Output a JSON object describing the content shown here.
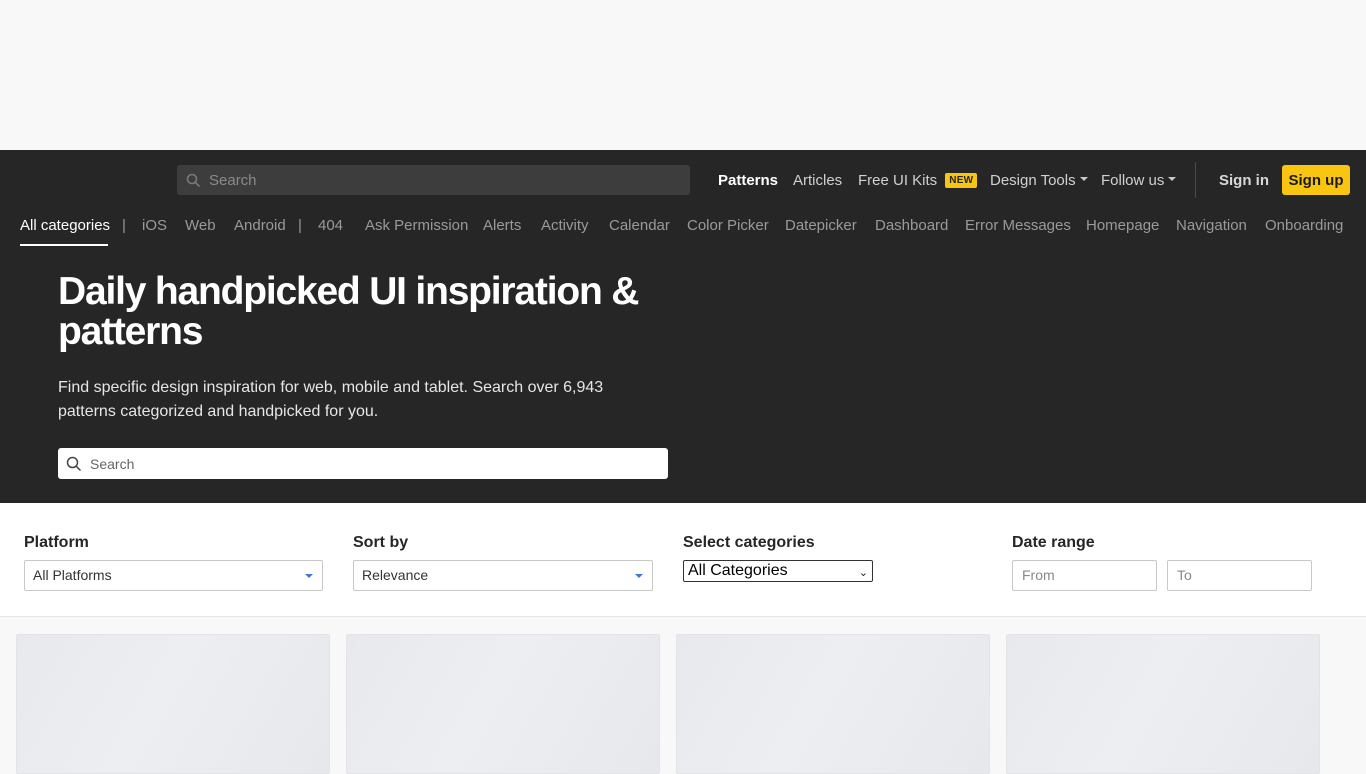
{
  "header": {
    "search_placeholder": "Search",
    "nav": {
      "patterns": "Patterns",
      "articles": "Articles",
      "free_ui_kits": "Free UI Kits",
      "new_badge": "NEW",
      "design_tools": "Design Tools",
      "follow_us": "Follow us",
      "sign_in": "Sign in",
      "sign_up": "Sign up"
    }
  },
  "categories": {
    "all": "All categories",
    "separator": "|",
    "platforms": [
      "iOS",
      "Web",
      "Android"
    ],
    "items": [
      "404",
      "Ask Permission",
      "Alerts",
      "Activity",
      "Calendar",
      "Color Picker",
      "Datepicker",
      "Dashboard",
      "Error Messages",
      "Homepage",
      "Navigation",
      "Onboarding"
    ]
  },
  "hero": {
    "title": "Daily handpicked UI inspiration & patterns",
    "subtitle": "Find specific design inspiration for web, mobile and tablet. Search over 6,943 patterns categorized and handpicked for you.",
    "search_placeholder": "Search"
  },
  "filters": {
    "platform_label": "Platform",
    "platform_value": "All Platforms",
    "sort_label": "Sort by",
    "sort_value": "Relevance",
    "categories_label": "Select categories",
    "categories_value": "All Categories",
    "date_label": "Date range",
    "from_placeholder": "From",
    "to_placeholder": "To"
  },
  "colors": {
    "dark_bg": "#262626",
    "accent": "#f8c611",
    "dropdown_caret": "#3a7bd5"
  },
  "icons": [
    "search-icon",
    "caret-down-icon",
    "chevron-down-icon"
  ]
}
